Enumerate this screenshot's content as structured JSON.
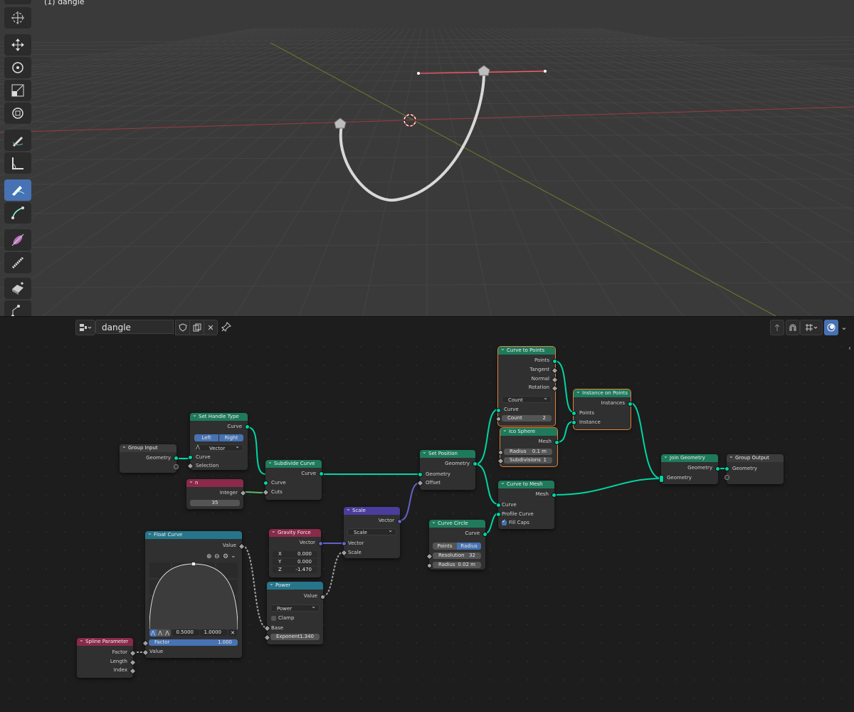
{
  "viewport": {
    "label": "(1) dangle",
    "tools": [
      "select-box-icon",
      "cursor-icon",
      "move-icon",
      "rotate-icon",
      "scale-icon",
      "transform-icon",
      "annotate-icon",
      "measure-icon",
      "draw-curve-icon",
      "pen-icon",
      "radius-icon",
      "tilt-icon",
      "randomize-icon",
      "extrude-cube-icon",
      "extrude-icon"
    ]
  },
  "node_editor": {
    "tree_name": "dangle",
    "colors": {
      "geometry_socket": "#00d6a3",
      "vector_socket": "#6363c7",
      "float_socket": "#a1a1a1",
      "int_socket": "#5dbb63",
      "selected_outline": "#e0803a",
      "accent": "#4772b3"
    }
  },
  "nodes": {
    "group_input": {
      "title": "Group Input",
      "geometry": "Geometry"
    },
    "set_handle_type": {
      "title": "Set Handle Type",
      "curve_out": "Curve",
      "left": "Left",
      "right": "Right",
      "handle_type": "Vector",
      "curve_in": "Curve",
      "selection": "Selection"
    },
    "n": {
      "title": "n",
      "integer": "Integer",
      "value": "35"
    },
    "subdivide_curve": {
      "title": "Subdivide Curve",
      "curve_out": "Curve",
      "curve_in": "Curve",
      "cuts": "Cuts"
    },
    "set_position": {
      "title": "Set Position",
      "geometry_out": "Geometry",
      "geometry_in": "Geometry",
      "offset": "Offset"
    },
    "curve_to_points": {
      "title": "Curve to Points",
      "points": "Points",
      "tangent": "Tangent",
      "normal": "Normal",
      "rotation": "Rotation",
      "mode": "Count",
      "curve": "Curve",
      "count_label": "Count",
      "count_value": "2"
    },
    "ico_sphere": {
      "title": "Ico Sphere",
      "mesh": "Mesh",
      "radius_label": "Radius",
      "radius_value": "0.1 m",
      "subdiv_label": "Subdivisions",
      "subdiv_value": "1"
    },
    "instance_on_points": {
      "title": "Instance on Points",
      "instances": "Instances",
      "points": "Points",
      "instance": "Instance"
    },
    "join_geometry": {
      "title": "Join Geometry",
      "geometry_out": "Geometry",
      "geometry_in": "Geometry"
    },
    "group_output": {
      "title": "Group Output",
      "geometry": "Geometry"
    },
    "curve_to_mesh": {
      "title": "Curve to Mesh",
      "mesh": "Mesh",
      "curve": "Curve",
      "profile": "Profile Curve",
      "fill_caps": "Fill Caps"
    },
    "curve_circle": {
      "title": "Curve Circle",
      "curve": "Curve",
      "points": "Points",
      "radius_mode": "Radius",
      "resolution_label": "Resolution",
      "resolution_value": "32",
      "radius_label": "Radius",
      "radius_value": "0.02 m"
    },
    "scale": {
      "title": "Scale",
      "vector_out": "Vector",
      "mode": "Scale",
      "vector_in": "Vector",
      "scale_in": "Scale"
    },
    "gravity_force": {
      "title": "Gravity Force",
      "vector": "Vector",
      "x_label": "X",
      "x_value": "0.000",
      "y_label": "Y",
      "y_value": "0.000",
      "z_label": "Z",
      "z_value": "-1.470"
    },
    "power": {
      "title": "Power",
      "value": "Value",
      "mode": "Power",
      "clamp": "Clamp",
      "base": "Base",
      "exponent_label": "Exponent",
      "exponent_value": "1.340"
    },
    "float_curve": {
      "title": "Float Curve",
      "value_out": "Value",
      "x_val": "0.5000",
      "y_val": "1.0000",
      "factor_label": "Factor",
      "factor_value": "1.000",
      "value_in": "Value"
    },
    "spline_parameter": {
      "title": "Spline Parameter",
      "factor": "Factor",
      "length": "Length",
      "index": "Index"
    }
  }
}
